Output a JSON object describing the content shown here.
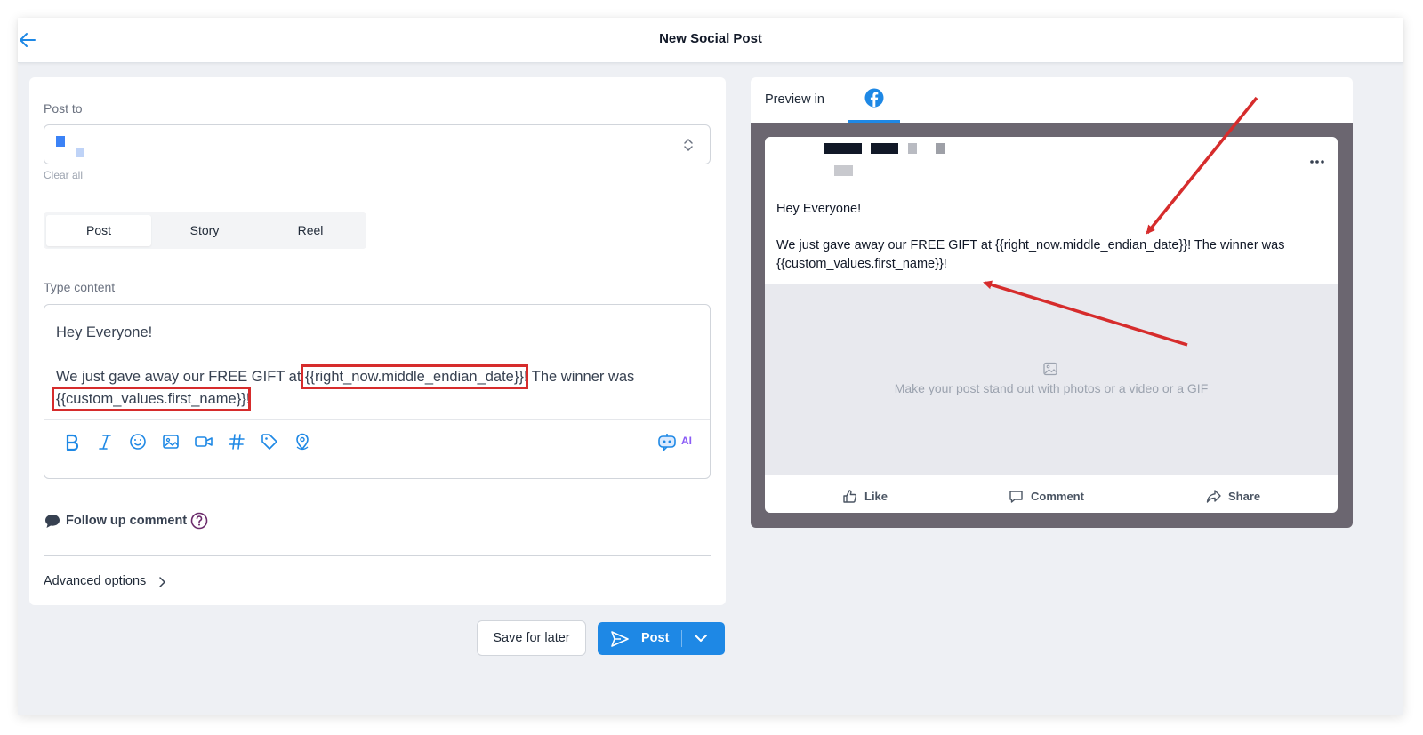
{
  "header": {
    "title": "New Social Post"
  },
  "composer": {
    "post_to_label": "Post to",
    "clear_all_label": "Clear all",
    "post_types": [
      "Post",
      "Story",
      "Reel"
    ],
    "active_post_type": "Post",
    "type_content_label": "Type content",
    "content": {
      "greeting": "Hey Everyone!",
      "line_prefix": "We just gave away our FREE GIFT at ",
      "date_token": "{{right_now.middle_endian_date}}",
      "line_middle": "! The winner was ",
      "name_token": "{{custom_values.first_name}}",
      "line_suffix": "!"
    },
    "toolbar_icons": [
      "bold-icon",
      "italic-icon",
      "emoji-icon",
      "image-icon",
      "video-icon",
      "hashtag-icon",
      "tag-icon",
      "location-icon"
    ],
    "ai_label": "AI",
    "follow_up_label": "Follow up comment",
    "advanced_label": "Advanced options"
  },
  "actions": {
    "save_label": "Save for later",
    "post_label": "Post"
  },
  "preview": {
    "label": "Preview in",
    "platform": "facebook",
    "greeting": "Hey Everyone!",
    "body": "We just gave away our FREE GIFT at {{right_now.middle_endian_date}}! The winner was {{custom_values.first_name}}!",
    "media_placeholder": "Make your post stand out with photos or a video or a GIF",
    "like_label": "Like",
    "comment_label": "Comment",
    "share_label": "Share"
  },
  "colors": {
    "accent": "#1e88e5",
    "annotation": "#d62c2c",
    "ai": "#8b5cf6"
  }
}
